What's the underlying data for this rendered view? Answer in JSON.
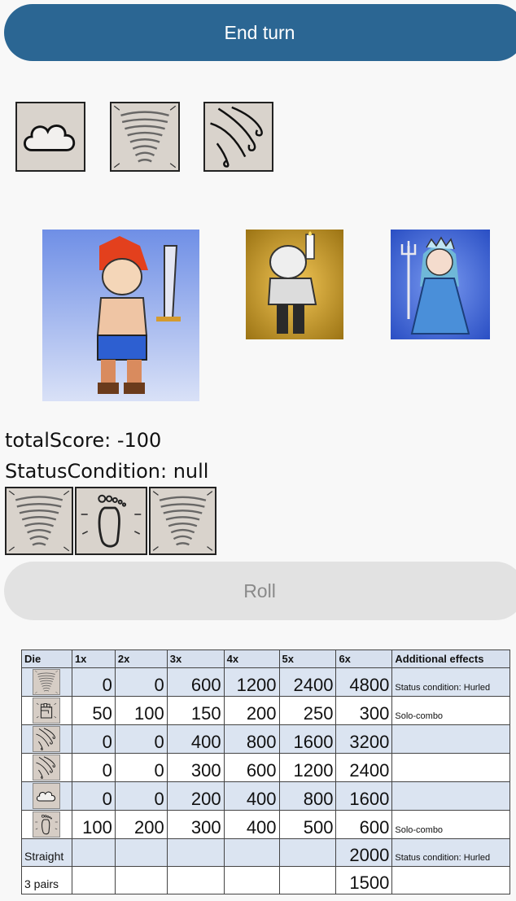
{
  "header": {
    "end_turn_label": "End turn"
  },
  "selected_dice": [
    {
      "icon": "cloud-icon"
    },
    {
      "icon": "tornado-icon"
    },
    {
      "icon": "wind-swirl-icon"
    }
  ],
  "characters": [
    {
      "icon": "red-haired-swordsman-portrait"
    },
    {
      "icon": "bearded-candle-man-portrait"
    },
    {
      "icon": "ice-queen-trident-portrait"
    }
  ],
  "status": {
    "total_score": "totalScore: -100",
    "status_condition": "StatusCondition: null"
  },
  "rolled_dice": [
    {
      "icon": "tornado-icon"
    },
    {
      "icon": "footprint-icon"
    },
    {
      "icon": "tornado-icon"
    }
  ],
  "actions": {
    "roll_label": "Roll"
  },
  "score_table": {
    "headers": [
      "Die",
      "1x",
      "2x",
      "3x",
      "4x",
      "5x",
      "6x",
      "Additional effects"
    ],
    "rows": [
      {
        "die": "tornado-icon",
        "label": "",
        "values": [
          "0",
          "0",
          "600",
          "1200",
          "2400",
          "4800"
        ],
        "effect": "Status condition: Hurled"
      },
      {
        "die": "fist-icon",
        "label": "",
        "values": [
          "50",
          "100",
          "150",
          "200",
          "250",
          "300"
        ],
        "effect": "Solo-combo"
      },
      {
        "die": "wind-swirl-icon",
        "label": "",
        "values": [
          "0",
          "0",
          "400",
          "800",
          "1600",
          "3200"
        ],
        "effect": ""
      },
      {
        "die": "wind-swirl-icon",
        "label": "",
        "values": [
          "0",
          "0",
          "300",
          "600",
          "1200",
          "2400"
        ],
        "effect": ""
      },
      {
        "die": "cloud-icon",
        "label": "",
        "values": [
          "0",
          "0",
          "200",
          "400",
          "800",
          "1600"
        ],
        "effect": ""
      },
      {
        "die": "footprint-icon",
        "label": "",
        "values": [
          "100",
          "200",
          "300",
          "400",
          "500",
          "600"
        ],
        "effect": "Solo-combo"
      },
      {
        "die": "",
        "label": "Straight",
        "values": [
          "",
          "",
          "",
          "",
          "",
          "2000"
        ],
        "effect": "Status condition: Hurled"
      },
      {
        "die": "",
        "label": "3 pairs",
        "values": [
          "",
          "",
          "",
          "",
          "",
          "1500"
        ],
        "effect": ""
      }
    ]
  },
  "colors": {
    "primary_button": "#2b6693",
    "disabled_button": "#e2e2e2",
    "table_header": "#d7e0ee",
    "table_band": "#dbe4f1"
  }
}
